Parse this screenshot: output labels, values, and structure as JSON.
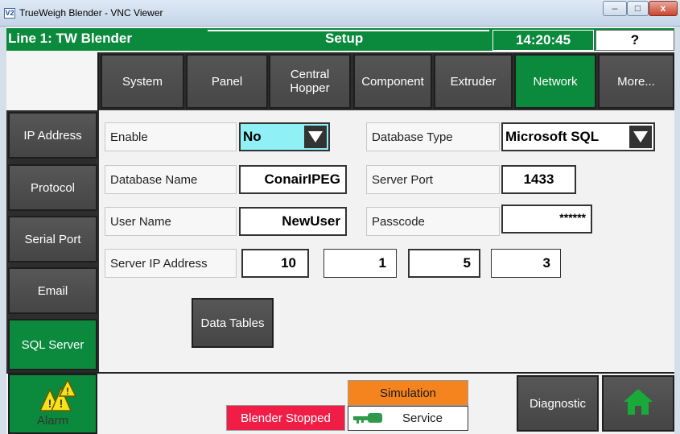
{
  "window": {
    "title": "TrueWeigh Blender - VNC Viewer",
    "app_icon": "V2",
    "controls": {
      "minimize": "–",
      "maximize": "□",
      "close": "x"
    }
  },
  "header": {
    "line": "Line 1: TW Blender",
    "screen": "Setup",
    "time": "14:20:45",
    "help": "?"
  },
  "tabs": [
    {
      "label": "System",
      "active": false
    },
    {
      "label": "Panel",
      "active": false
    },
    {
      "label": "Central\nHopper",
      "active": false
    },
    {
      "label": "Component",
      "active": false
    },
    {
      "label": "Extruder",
      "active": false
    },
    {
      "label": "Network",
      "active": true
    },
    {
      "label": "More...",
      "active": false
    }
  ],
  "sidebar": [
    {
      "label": "IP Address",
      "active": false
    },
    {
      "label": "Protocol",
      "active": false
    },
    {
      "label": "Serial Port",
      "active": false
    },
    {
      "label": "Email",
      "active": false
    },
    {
      "label": "SQL Server",
      "active": true
    }
  ],
  "form": {
    "enable": {
      "label": "Enable",
      "value": "No"
    },
    "database_type": {
      "label": "Database Type",
      "value": "Microsoft SQL"
    },
    "database_name": {
      "label": "Database Name",
      "value": "ConairIPEG"
    },
    "server_port": {
      "label": "Server Port",
      "value": "1433"
    },
    "user_name": {
      "label": "User Name",
      "value": "NewUser"
    },
    "passcode": {
      "label": "Passcode",
      "value": "******"
    },
    "server_ip": {
      "label": "Server IP Address",
      "octets": [
        "10",
        "1",
        "5",
        "3"
      ]
    },
    "data_tables_button": "Data Tables"
  },
  "footer": {
    "alarm": "Alarm",
    "status": "Blender Stopped",
    "simulation": "Simulation",
    "service": "Service",
    "diagnostic": "Diagnostic",
    "home_icon": "home-icon"
  },
  "colors": {
    "green": "#0b8a3d",
    "button_gray": "#4d4d4d",
    "status_red": "#f01e46",
    "simulation_orange": "#f5841f",
    "enable_cyan": "#8ff0f5"
  }
}
